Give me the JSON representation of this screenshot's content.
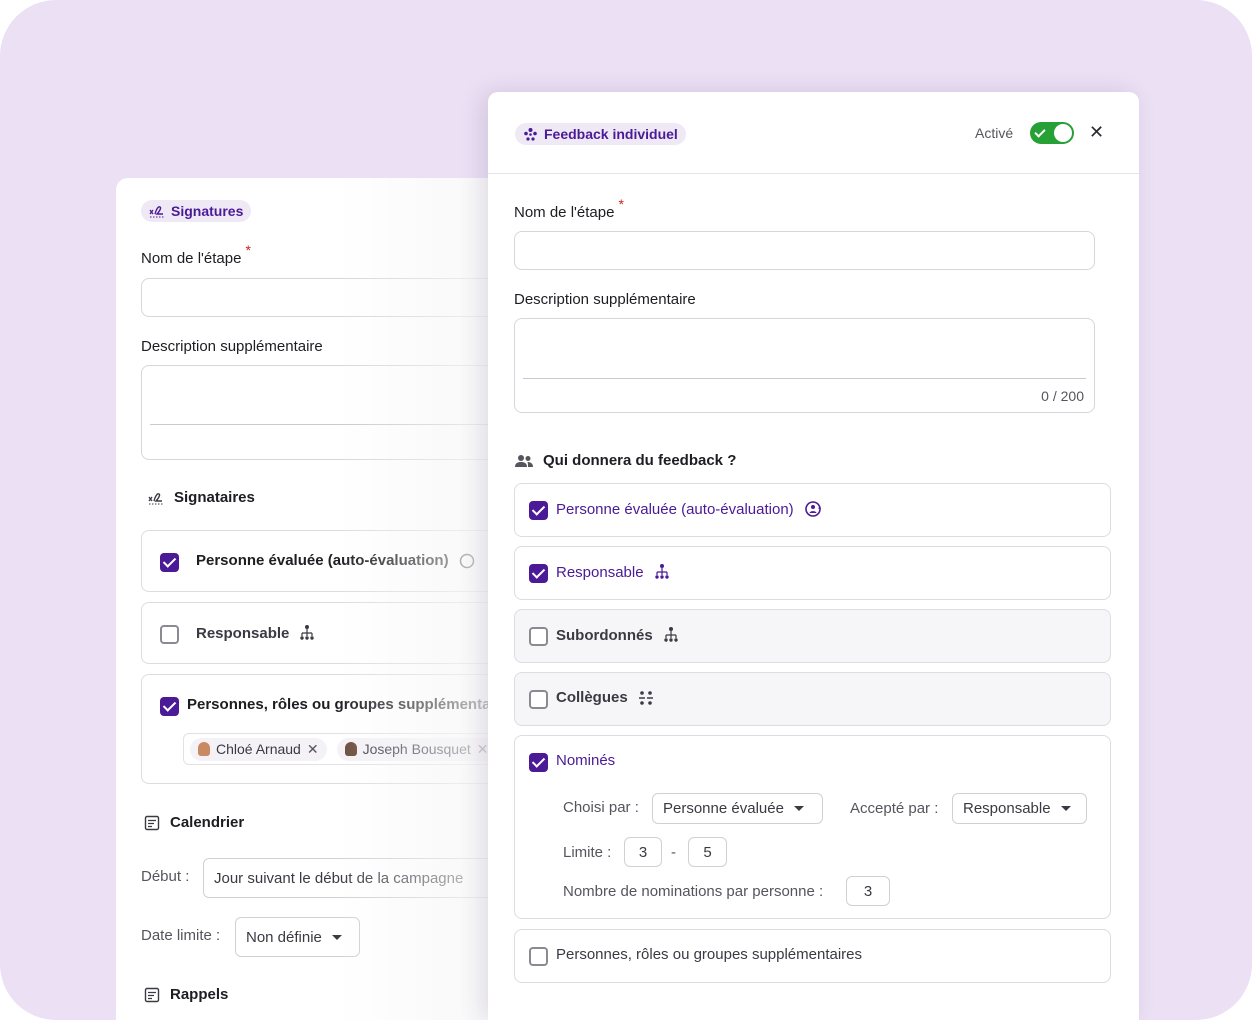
{
  "back": {
    "badge": "Signatures",
    "step_name_label": "Nom de l'étape",
    "required_mark": "*",
    "description_label": "Description supplémentaire",
    "signers_title": "Signataires",
    "options": [
      {
        "label": "Personne évaluée (auto-évaluation)",
        "checked": true
      },
      {
        "label": "Responsable",
        "checked": false
      },
      {
        "label": "Personnes, rôles ou groupes supplémentaires",
        "checked": true
      }
    ],
    "chips": [
      "Chloé Arnaud",
      "Joseph Bousquet"
    ],
    "calendar_title": "Calendrier",
    "start_label": "Début :",
    "start_value": "Jour suivant le début de la campagne",
    "deadline_label": "Date limite :",
    "deadline_value": "Non définie",
    "reminders_title": "Rappels"
  },
  "front": {
    "badge": "Feedback individuel",
    "active_label": "Activé",
    "active": true,
    "step_name_label": "Nom de l'étape",
    "required_mark": "*",
    "description_label": "Description supplémentaire",
    "char_count": "0 / 200",
    "who_title": "Qui donnera du feedback ?",
    "options": [
      {
        "label": "Personne évaluée (auto-évaluation)",
        "checked": true
      },
      {
        "label": "Responsable",
        "checked": true
      },
      {
        "label": "Subordonnés",
        "checked": false
      },
      {
        "label": "Collègues",
        "checked": false
      },
      {
        "label": "Nominés",
        "checked": true
      },
      {
        "label": "Personnes, rôles ou groupes supplémentaires",
        "checked": false
      }
    ],
    "nominees": {
      "chosen_by_label": "Choisi par :",
      "chosen_by_value": "Personne évaluée",
      "accepted_by_label": "Accepté par :",
      "accepted_by_value": "Responsable",
      "limit_label": "Limite :",
      "limit_min": "3",
      "limit_sep": "-",
      "limit_max": "5",
      "per_person_label": "Nombre de nominations par personne :",
      "per_person_value": "3"
    }
  },
  "colors": {
    "accent": "#4b1a96",
    "toggle_on": "#27a035",
    "required": "#d21c1c",
    "background": "#ebe0f4"
  }
}
